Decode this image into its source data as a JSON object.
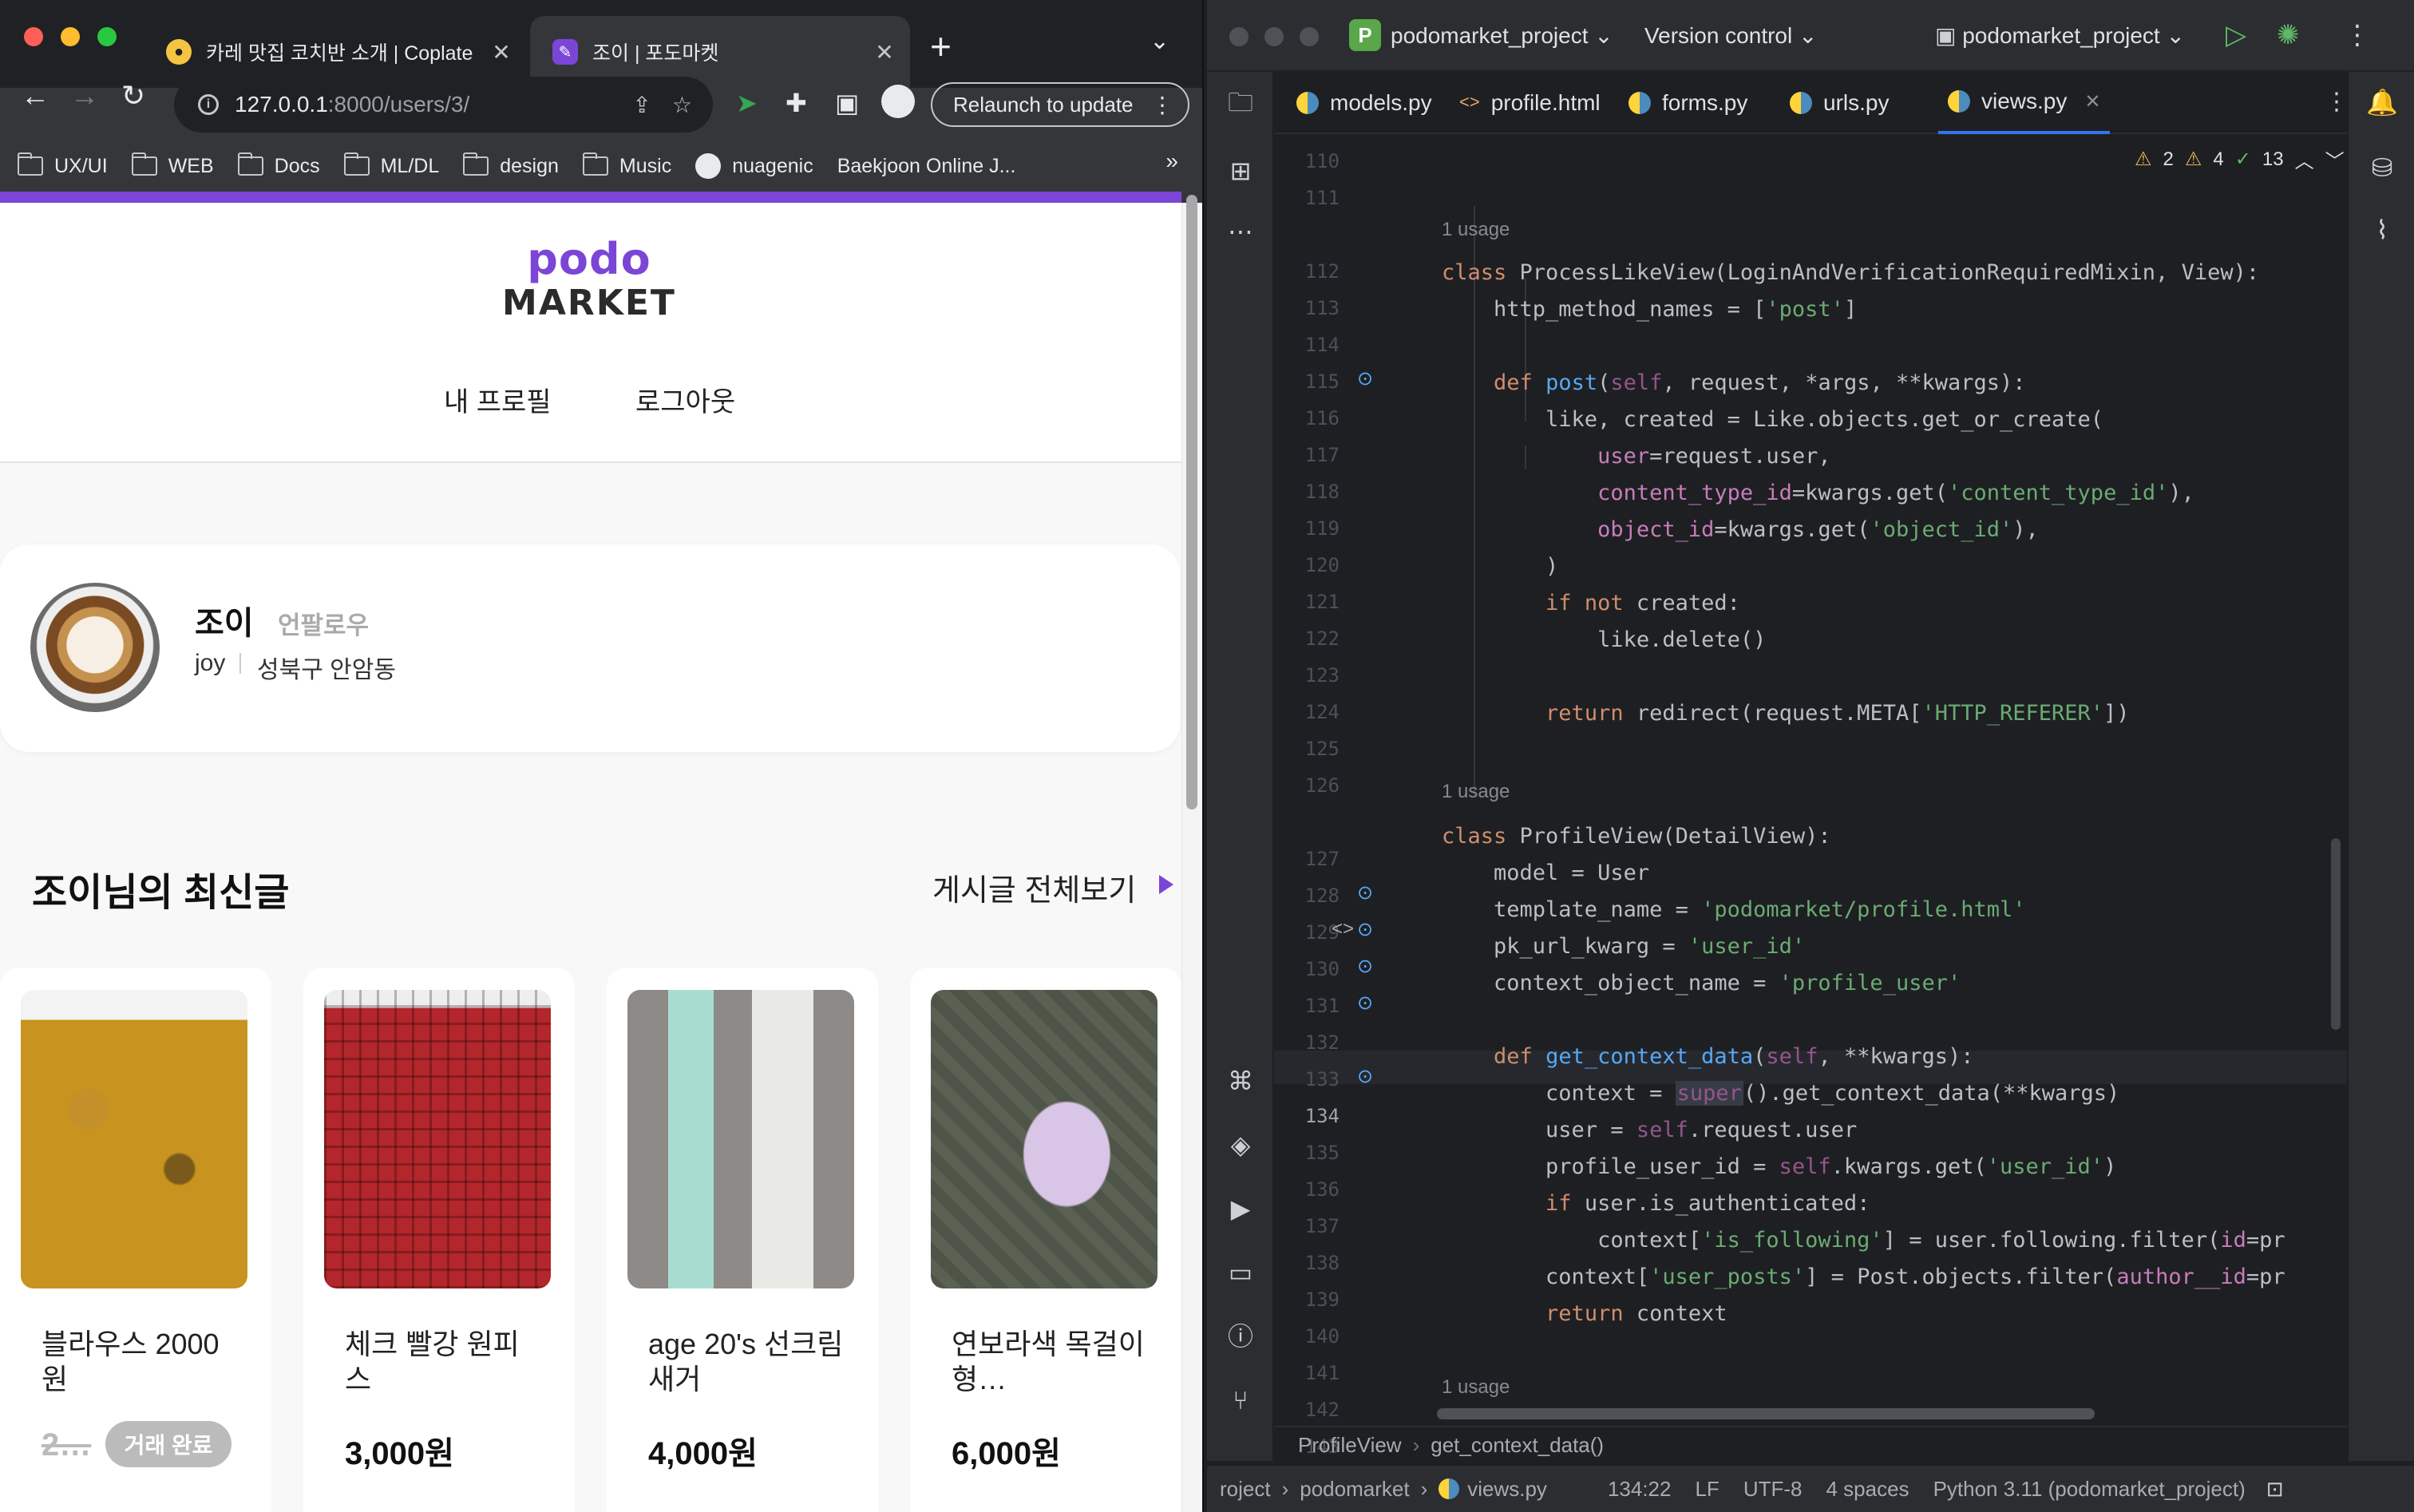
{
  "browser": {
    "tabs": [
      {
        "title": "카레 맛집 코치반 소개 | Coplate",
        "close": "✕"
      },
      {
        "title": "조이 | 포도마켓",
        "close": "✕"
      }
    ],
    "new_tab": "+",
    "tab_search": "⌄",
    "url_host": "127.0.0.1",
    "url_path": ":8000/users/3/",
    "relaunch_label": "Relaunch to update",
    "bookmarks": [
      "UX/UI",
      "WEB",
      "Docs",
      "ML/DL",
      "design",
      "Music",
      "nuagenic",
      "Baekjoon Online J..."
    ],
    "bookmarks_more": "»"
  },
  "site": {
    "logo_top": "podo",
    "logo_bottom": "MARKET",
    "nav": [
      "내 프로필",
      "로그아웃"
    ],
    "profile": {
      "nickname": "조이",
      "follow_label": "언팔로우",
      "username": "joy",
      "location": "성북구 안암동"
    },
    "posts_title": "조이님의 최신글",
    "see_all": "게시글 전체보기",
    "products": [
      {
        "title": "블라우스 2000원",
        "price": "2…",
        "badge": "거래 완료",
        "sold": true
      },
      {
        "title": "체크 빨강 원피스",
        "price": "3,000원",
        "badge": "",
        "sold": false
      },
      {
        "title": "age 20's 선크림 새거",
        "price": "4,000원",
        "badge": "",
        "sold": false
      },
      {
        "title": "연보라색 목걸이형…",
        "price": "6,000원",
        "badge": "",
        "sold": false
      }
    ]
  },
  "ide": {
    "project_initial": "P",
    "project": "podomarket_project",
    "vcs": "Version control",
    "run_config": "podomarket_project",
    "file_tabs": [
      {
        "name": "models.py",
        "type": "py"
      },
      {
        "name": "profile.html",
        "type": "html"
      },
      {
        "name": "forms.py",
        "type": "py"
      },
      {
        "name": "urls.py",
        "type": "py"
      },
      {
        "name": "views.py",
        "type": "py",
        "active": true
      }
    ],
    "inspections": {
      "warnings": "2",
      "weak": "4",
      "ok": "13"
    },
    "usage_hint": "1 usage",
    "lines": [
      "110",
      "111",
      "112",
      "113",
      "114",
      "115",
      "116",
      "117",
      "118",
      "119",
      "120",
      "121",
      "122",
      "123",
      "124",
      "125",
      "126",
      "127",
      "128",
      "129",
      "130",
      "131",
      "132",
      "133",
      "134",
      "135",
      "136",
      "137",
      "138",
      "139",
      "140",
      "141",
      "142",
      "143"
    ],
    "breadcrumb": [
      "ProfileView",
      "get_context_data()"
    ],
    "status": {
      "path": [
        "roject",
        "podomarket",
        "views.py"
      ],
      "position": "134:22",
      "line_sep": "LF",
      "encoding": "UTF-8",
      "indent": "4 spaces",
      "interpreter": "Python 3.11 (podomarket_project)"
    }
  }
}
